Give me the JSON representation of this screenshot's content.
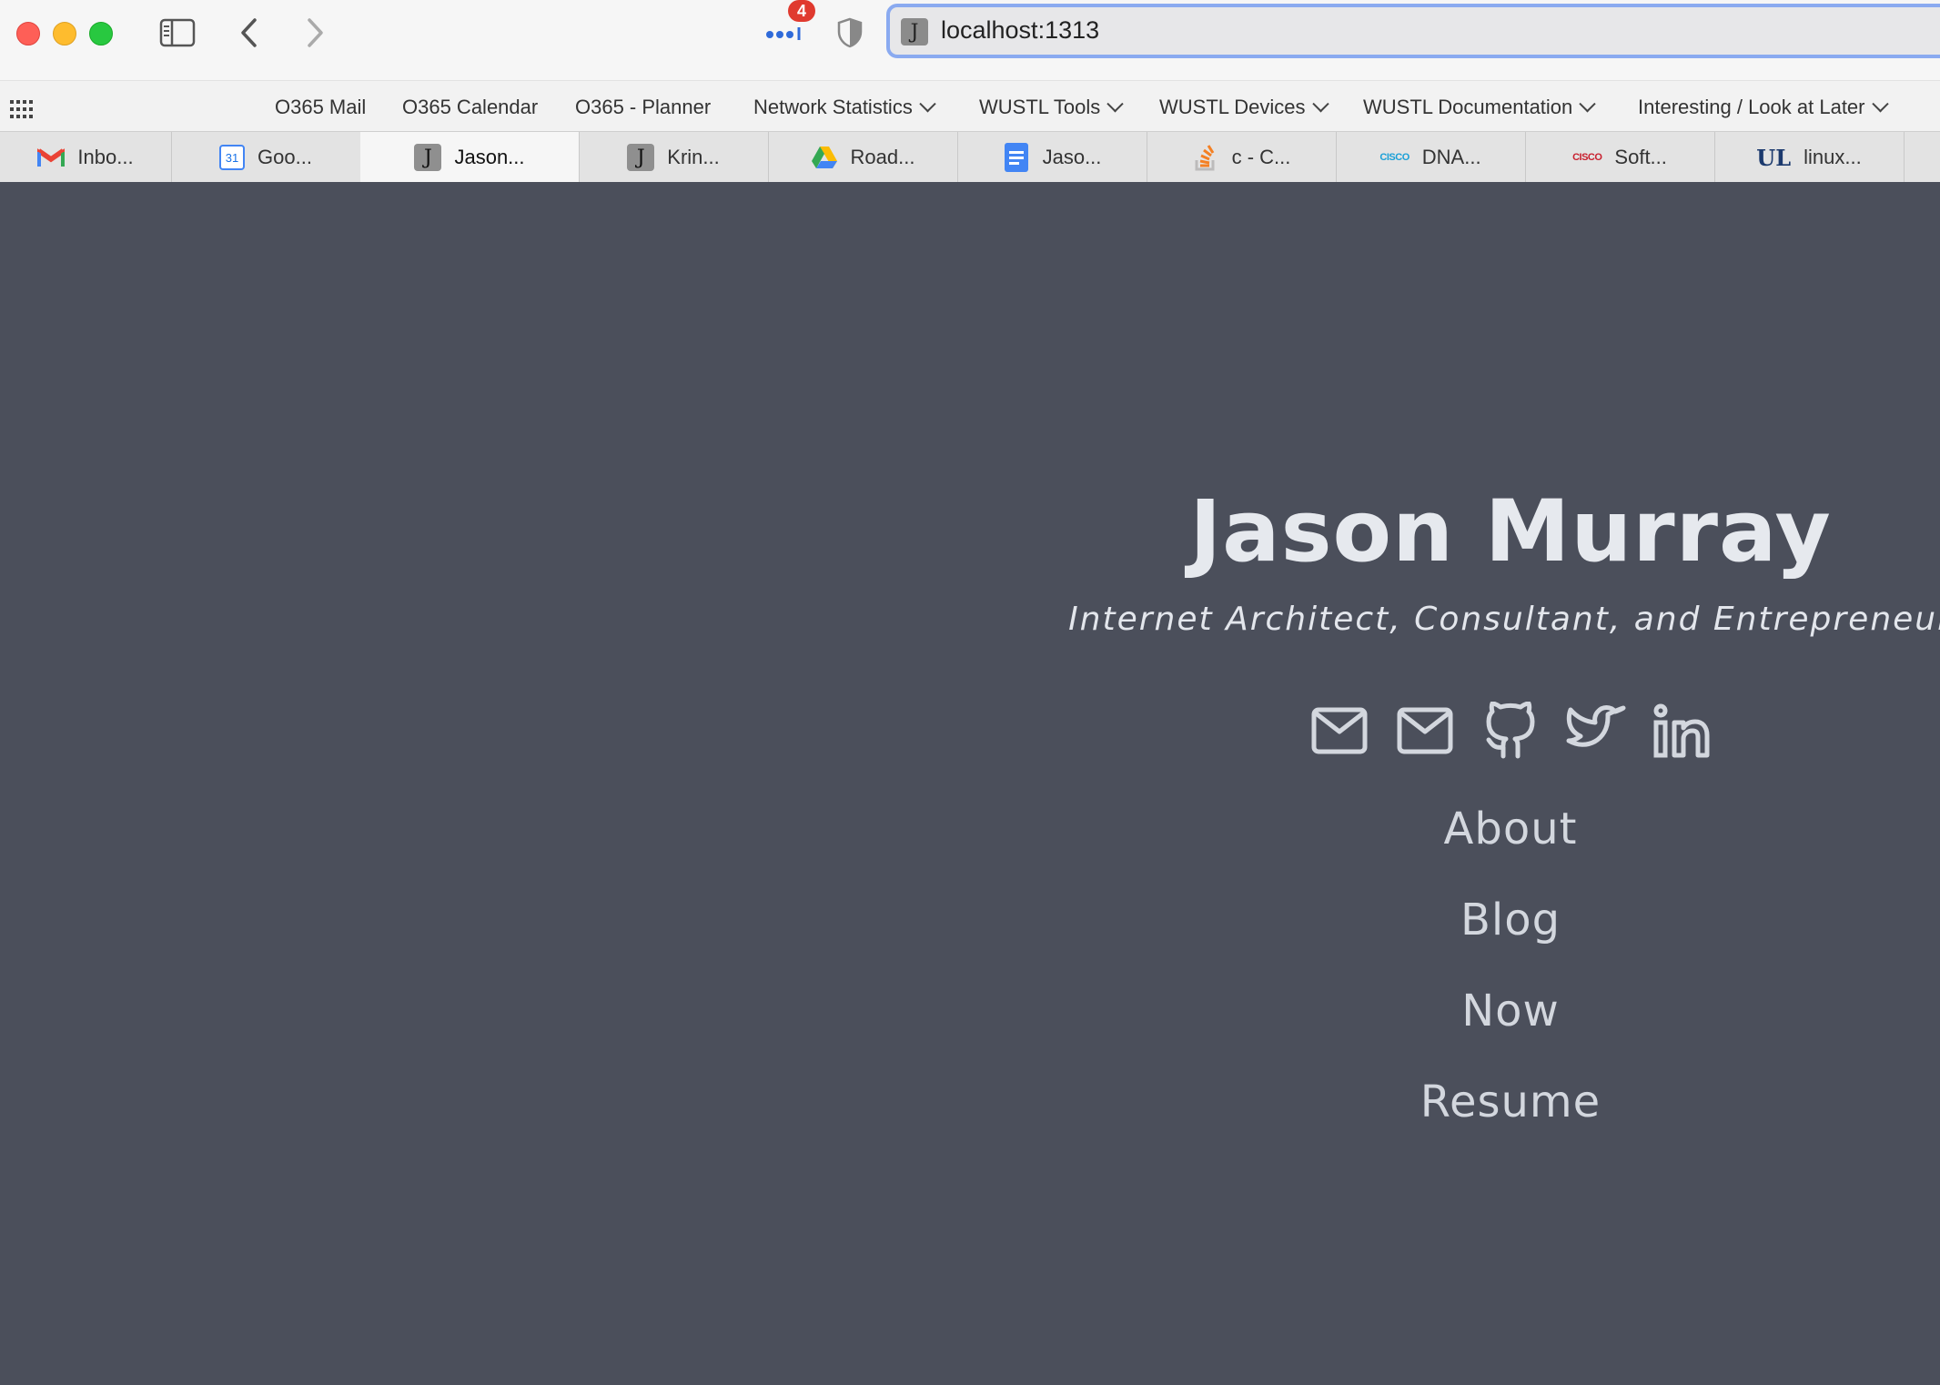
{
  "browser": {
    "extension_badge": "4",
    "address": "localhost:1313",
    "address_favicon": "J"
  },
  "bookmarks": [
    {
      "label": "O365 Mail",
      "folder": false
    },
    {
      "label": "O365 Calendar",
      "folder": false
    },
    {
      "label": "O365 - Planner",
      "folder": false
    },
    {
      "label": "Network Statistics",
      "folder": true
    },
    {
      "label": "WUSTL Tools",
      "folder": true
    },
    {
      "label": "WUSTL Devices",
      "folder": true
    },
    {
      "label": "WUSTL Documentation",
      "folder": true
    },
    {
      "label": "Interesting / Look at Later",
      "folder": true
    }
  ],
  "tabs": [
    {
      "label": "Inbo...",
      "icon": "gmail-icon"
    },
    {
      "label": "Goo...",
      "icon": "google-calendar-icon",
      "icon_text": "31"
    },
    {
      "label": "Jason...",
      "icon": "site-j-icon",
      "icon_text": "J",
      "active": true
    },
    {
      "label": "Krin...",
      "icon": "site-j-icon",
      "icon_text": "J"
    },
    {
      "label": "Road...",
      "icon": "google-drive-icon"
    },
    {
      "label": "Jaso...",
      "icon": "google-docs-icon"
    },
    {
      "label": "c - C...",
      "icon": "stackoverflow-icon"
    },
    {
      "label": "DNA...",
      "icon": "cisco-icon",
      "icon_text": "CISCO"
    },
    {
      "label": "Soft...",
      "icon": "cisco-icon",
      "icon_text": "CISCO"
    },
    {
      "label": "linux...",
      "icon": "university-icon",
      "icon_text": "UL"
    }
  ],
  "site": {
    "title": "Jason Murray",
    "subtitle": "Internet Architect, Consultant, and Entrepreneur",
    "social": [
      "email-icon",
      "email-icon",
      "github-icon",
      "twitter-icon",
      "linkedin-icon"
    ],
    "nav": [
      "About",
      "Blog",
      "Now",
      "Resume"
    ]
  },
  "colors": {
    "page_background": "#4b4f5b",
    "title_text": "#e6e9ee",
    "nav_text": "#d3d7de",
    "address_focus_ring": "#8aaaf0",
    "badge": "#e03a2f"
  }
}
